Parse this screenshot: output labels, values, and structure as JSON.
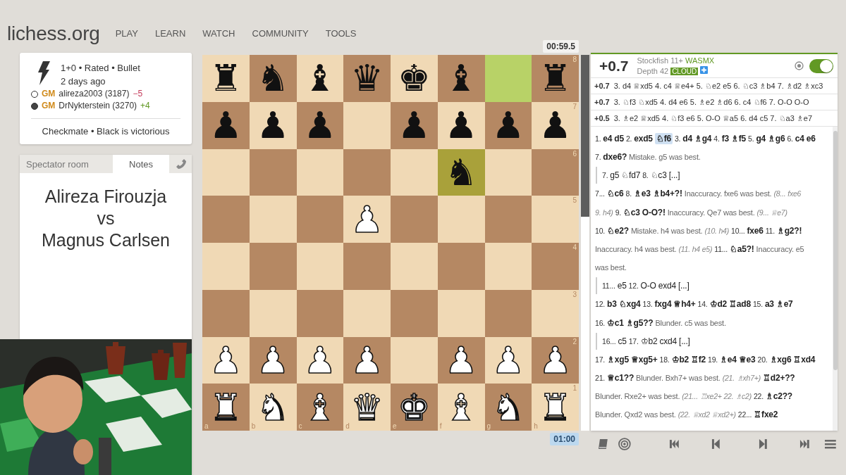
{
  "header": {
    "logo": "lichess.org",
    "nav": [
      "PLAY",
      "LEARN",
      "WATCH",
      "COMMUNITY",
      "TOOLS"
    ]
  },
  "game": {
    "info": "1+0 • Rated • Bullet",
    "time": "2 days ago",
    "players": [
      {
        "white": true,
        "title": "GM",
        "name": "alireza2003 (3187)",
        "diff": "−5",
        "gain": false
      },
      {
        "white": false,
        "title": "GM",
        "name": "DrNykterstein (3270)",
        "diff": "+4",
        "gain": true
      }
    ],
    "result": "Checkmate • Black is victorious"
  },
  "chat": {
    "tabs": [
      {
        "label": "Spectator room",
        "selected": false
      },
      {
        "label": "Notes",
        "selected": true
      }
    ],
    "notes": [
      "Alireza Firouzja",
      "vs",
      "Magnus Carlsen"
    ]
  },
  "board": {
    "clock_top": "00:59.5",
    "clock_bottom": "01:00",
    "rank_labels": [
      "8",
      "7",
      "6",
      "5",
      "4",
      "3",
      "2",
      "1"
    ],
    "file_labels": [
      "a",
      "b",
      "c",
      "d",
      "e",
      "f",
      "g",
      "h"
    ],
    "ranks": [
      [
        {
          "piece": "♜",
          "white": false,
          "highlighted": false
        },
        {
          "piece": "♞",
          "white": false,
          "highlighted": false
        },
        {
          "piece": "♝",
          "white": false,
          "highlighted": false
        },
        {
          "piece": "♛",
          "white": false,
          "highlighted": false
        },
        {
          "piece": "♚",
          "white": false,
          "highlighted": false
        },
        {
          "piece": "♝",
          "white": false,
          "highlighted": false
        },
        {
          "highlighted": true
        },
        {
          "piece": "♜",
          "white": false,
          "highlighted": false
        }
      ],
      [
        {
          "piece": "♟",
          "white": false,
          "highlighted": false
        },
        {
          "piece": "♟",
          "white": false,
          "highlighted": false
        },
        {
          "piece": "♟",
          "white": false,
          "highlighted": false
        },
        {
          "highlighted": false
        },
        {
          "piece": "♟",
          "white": false,
          "highlighted": false
        },
        {
          "piece": "♟",
          "white": false,
          "highlighted": false
        },
        {
          "piece": "♟",
          "white": false,
          "highlighted": false
        },
        {
          "piece": "♟",
          "white": false,
          "highlighted": false
        }
      ],
      [
        {
          "highlighted": false
        },
        {
          "highlighted": false
        },
        {
          "highlighted": false
        },
        {
          "highlighted": false
        },
        {
          "highlighted": false
        },
        {
          "piece": "♞",
          "white": false,
          "highlighted": true
        },
        {
          "highlighted": false
        },
        {
          "highlighted": false
        }
      ],
      [
        {
          "highlighted": false
        },
        {
          "highlighted": false
        },
        {
          "highlighted": false
        },
        {
          "piece": "♟",
          "white": true,
          "highlighted": false
        },
        {
          "highlighted": false
        },
        {
          "highlighted": false
        },
        {
          "highlighted": false
        },
        {
          "highlighted": false
        }
      ],
      [
        {
          "highlighted": false
        },
        {
          "highlighted": false
        },
        {
          "highlighted": false
        },
        {
          "highlighted": false
        },
        {
          "highlighted": false
        },
        {
          "highlighted": false
        },
        {
          "highlighted": false
        },
        {
          "highlighted": false
        }
      ],
      [
        {
          "highlighted": false
        },
        {
          "highlighted": false
        },
        {
          "highlighted": false
        },
        {
          "highlighted": false
        },
        {
          "highlighted": false
        },
        {
          "highlighted": false
        },
        {
          "highlighted": false
        },
        {
          "highlighted": false
        }
      ],
      [
        {
          "piece": "♟",
          "white": true,
          "highlighted": false
        },
        {
          "piece": "♟",
          "white": true,
          "highlighted": false
        },
        {
          "piece": "♟",
          "white": true,
          "highlighted": false
        },
        {
          "piece": "♟",
          "white": true,
          "highlighted": false
        },
        {
          "highlighted": false
        },
        {
          "piece": "♟",
          "white": true,
          "highlighted": false
        },
        {
          "piece": "♟",
          "white": true,
          "highlighted": false
        },
        {
          "piece": "♟",
          "white": true,
          "highlighted": false
        }
      ],
      [
        {
          "piece": "♜",
          "white": true,
          "highlighted": false
        },
        {
          "piece": "♞",
          "white": true,
          "highlighted": false
        },
        {
          "piece": "♝",
          "white": true,
          "highlighted": false
        },
        {
          "piece": "♛",
          "white": true,
          "highlighted": false
        },
        {
          "piece": "♚",
          "white": true,
          "highlighted": false
        },
        {
          "piece": "♝",
          "white": true,
          "highlighted": false
        },
        {
          "piece": "♞",
          "white": true,
          "highlighted": false
        },
        {
          "piece": "♜",
          "white": true,
          "highlighted": false
        }
      ]
    ]
  },
  "gauge": {
    "level": 0.57
  },
  "analysis": {
    "eval": "+0.7",
    "engine": "Stockfish 11+",
    "engine_tag": "WASMX",
    "depth": "Depth 42",
    "cloud": "CLOUD",
    "enabled": true,
    "pvs": [
      {
        "eval": "+0.7",
        "moves": "3. d4 ♕xd5 4. c4 ♕e4+ 5. ♘e2 e5 6. ♘c3 ♗b4 7. ♗d2 ♗xc3"
      },
      {
        "eval": "+0.7",
        "moves": "3. ♘f3 ♘xd5 4. d4 e6 5. ♗e2 ♗d6 6. c4 ♘f6 7. O-O O-O"
      },
      {
        "eval": "+0.5",
        "moves": "3. ♗e2 ♕xd5 4. ♘f3 e6 5. O-O ♕a5 6. d4 c5 7. ♘a3 ♗e7"
      }
    ],
    "lines": [
      {
        "kind": "main",
        "parts": [
          {
            "kind": "number",
            "text": "1."
          },
          {
            "kind": "move",
            "text": "e4"
          },
          {
            "kind": "move",
            "text": "d5"
          },
          {
            "kind": "number",
            "text": "2."
          },
          {
            "kind": "move",
            "text": "exd5"
          },
          {
            "kind": "current",
            "text": "♘f6"
          },
          {
            "kind": "number",
            "text": "3."
          },
          {
            "kind": "move",
            "text": "d4"
          },
          {
            "kind": "move",
            "text": "♗g4"
          },
          {
            "kind": "number",
            "text": "4."
          },
          {
            "kind": "move",
            "text": "f3"
          },
          {
            "kind": "move",
            "text": "♗f5"
          },
          {
            "kind": "number",
            "text": "5."
          },
          {
            "kind": "move",
            "text": "g4"
          },
          {
            "kind": "move",
            "text": "♗g6"
          },
          {
            "kind": "number",
            "text": "6."
          },
          {
            "kind": "move",
            "text": "c4"
          },
          {
            "kind": "move",
            "text": "e6"
          }
        ]
      },
      {
        "kind": "main",
        "parts": [
          {
            "kind": "number",
            "text": "7."
          },
          {
            "kind": "move",
            "text": "dxe6?"
          },
          {
            "kind": "comment",
            "text": "Mistake. g5 was best."
          }
        ]
      },
      {
        "kind": "variation",
        "parts": [
          {
            "kind": "number",
            "text": "7."
          },
          {
            "kind": "move",
            "text": "g5"
          },
          {
            "kind": "move",
            "text": "♘fd7"
          },
          {
            "kind": "number",
            "text": "8."
          },
          {
            "kind": "move",
            "text": "♘c3"
          },
          {
            "kind": "move",
            "text": "[...]"
          }
        ]
      },
      {
        "kind": "main",
        "parts": [
          {
            "kind": "number",
            "text": "7..."
          },
          {
            "kind": "move",
            "text": "♘c6"
          },
          {
            "kind": "number",
            "text": "8."
          },
          {
            "kind": "move",
            "text": "♗e3"
          },
          {
            "kind": "move",
            "text": "♗b4+?!"
          },
          {
            "kind": "comment",
            "text": "Inaccuracy. fxe6 was best."
          },
          {
            "kind": "variation",
            "text": "(8... fxe6"
          }
        ]
      },
      {
        "kind": "main",
        "parts": [
          {
            "kind": "variation",
            "text": "9. h4)"
          },
          {
            "kind": "number",
            "text": "9."
          },
          {
            "kind": "move",
            "text": "♘c3"
          },
          {
            "kind": "move",
            "text": "O-O?!"
          },
          {
            "kind": "comment",
            "text": "Inaccuracy. Qe7 was best."
          },
          {
            "kind": "variation",
            "text": "(9... ♕e7)"
          }
        ]
      },
      {
        "kind": "main",
        "parts": [
          {
            "kind": "number",
            "text": "10."
          },
          {
            "kind": "move",
            "text": "♘e2?"
          },
          {
            "kind": "comment",
            "text": "Mistake. h4 was best."
          },
          {
            "kind": "variation",
            "text": "(10. h4)"
          },
          {
            "kind": "number",
            "text": "10..."
          },
          {
            "kind": "move",
            "text": "fxe6"
          },
          {
            "kind": "number",
            "text": "11."
          },
          {
            "kind": "move",
            "text": "♗g2?!"
          }
        ]
      },
      {
        "kind": "main",
        "parts": [
          {
            "kind": "comment",
            "text": "Inaccuracy. h4 was best."
          },
          {
            "kind": "variation",
            "text": "(11. h4 e5)"
          },
          {
            "kind": "number",
            "text": "11..."
          },
          {
            "kind": "move",
            "text": "♘a5?!"
          },
          {
            "kind": "comment",
            "text": "Inaccuracy. e5"
          }
        ]
      },
      {
        "kind": "main",
        "parts": [
          {
            "kind": "comment",
            "text": "was best."
          }
        ]
      },
      {
        "kind": "variation",
        "parts": [
          {
            "kind": "number",
            "text": "11..."
          },
          {
            "kind": "move",
            "text": "e5"
          },
          {
            "kind": "number",
            "text": "12."
          },
          {
            "kind": "move",
            "text": "O-O"
          },
          {
            "kind": "move",
            "text": "exd4"
          },
          {
            "kind": "move",
            "text": "[...]"
          }
        ]
      },
      {
        "kind": "main",
        "parts": [
          {
            "kind": "number",
            "text": "12."
          },
          {
            "kind": "move",
            "text": "b3"
          },
          {
            "kind": "move",
            "text": "♘xg4"
          },
          {
            "kind": "number",
            "text": "13."
          },
          {
            "kind": "move",
            "text": "fxg4"
          },
          {
            "kind": "move",
            "text": "♕h4+"
          },
          {
            "kind": "number",
            "text": "14."
          },
          {
            "kind": "move",
            "text": "♔d2"
          },
          {
            "kind": "move",
            "text": "♖ad8"
          },
          {
            "kind": "number",
            "text": "15."
          },
          {
            "kind": "move",
            "text": "a3"
          },
          {
            "kind": "move",
            "text": "♗e7"
          }
        ]
      },
      {
        "kind": "main",
        "parts": [
          {
            "kind": "number",
            "text": "16."
          },
          {
            "kind": "move",
            "text": "♔c1"
          },
          {
            "kind": "move",
            "text": "♗g5??"
          },
          {
            "kind": "comment",
            "text": "Blunder. c5 was best."
          }
        ]
      },
      {
        "kind": "variation",
        "parts": [
          {
            "kind": "number",
            "text": "16..."
          },
          {
            "kind": "move",
            "text": "c5"
          },
          {
            "kind": "number",
            "text": "17."
          },
          {
            "kind": "move",
            "text": "♔b2"
          },
          {
            "kind": "move",
            "text": "cxd4"
          },
          {
            "kind": "move",
            "text": "[...]"
          }
        ]
      },
      {
        "kind": "main",
        "parts": [
          {
            "kind": "number",
            "text": "17."
          },
          {
            "kind": "move",
            "text": "♗xg5"
          },
          {
            "kind": "move",
            "text": "♕xg5+"
          },
          {
            "kind": "number",
            "text": "18."
          },
          {
            "kind": "move",
            "text": "♔b2"
          },
          {
            "kind": "move",
            "text": "♖f2"
          },
          {
            "kind": "number",
            "text": "19."
          },
          {
            "kind": "move",
            "text": "♗e4"
          },
          {
            "kind": "move",
            "text": "♕e3"
          },
          {
            "kind": "number",
            "text": "20."
          },
          {
            "kind": "move",
            "text": "♗xg6"
          },
          {
            "kind": "move",
            "text": "♖xd4"
          }
        ]
      },
      {
        "kind": "main",
        "parts": [
          {
            "kind": "number",
            "text": "21."
          },
          {
            "kind": "move",
            "text": "♕c1??"
          },
          {
            "kind": "comment",
            "text": "Blunder. Bxh7+ was best."
          },
          {
            "kind": "variation",
            "text": "(21. ♗xh7+)"
          },
          {
            "kind": "move",
            "text": "♖d2+??"
          }
        ]
      },
      {
        "kind": "main",
        "parts": [
          {
            "kind": "comment",
            "text": "Blunder. Rxe2+ was best."
          },
          {
            "kind": "variation",
            "text": "(21... ♖xe2+ 22. ♗c2)"
          },
          {
            "kind": "number",
            "text": "22."
          },
          {
            "kind": "move",
            "text": "♗c2??"
          }
        ]
      },
      {
        "kind": "main",
        "parts": [
          {
            "kind": "comment",
            "text": "Blunder. Qxd2 was best."
          },
          {
            "kind": "variation",
            "text": "(22. ♕xd2 ♕xd2+)"
          },
          {
            "kind": "number",
            "text": "22..."
          },
          {
            "kind": "move",
            "text": "♖fxe2"
          }
        ]
      }
    ]
  }
}
